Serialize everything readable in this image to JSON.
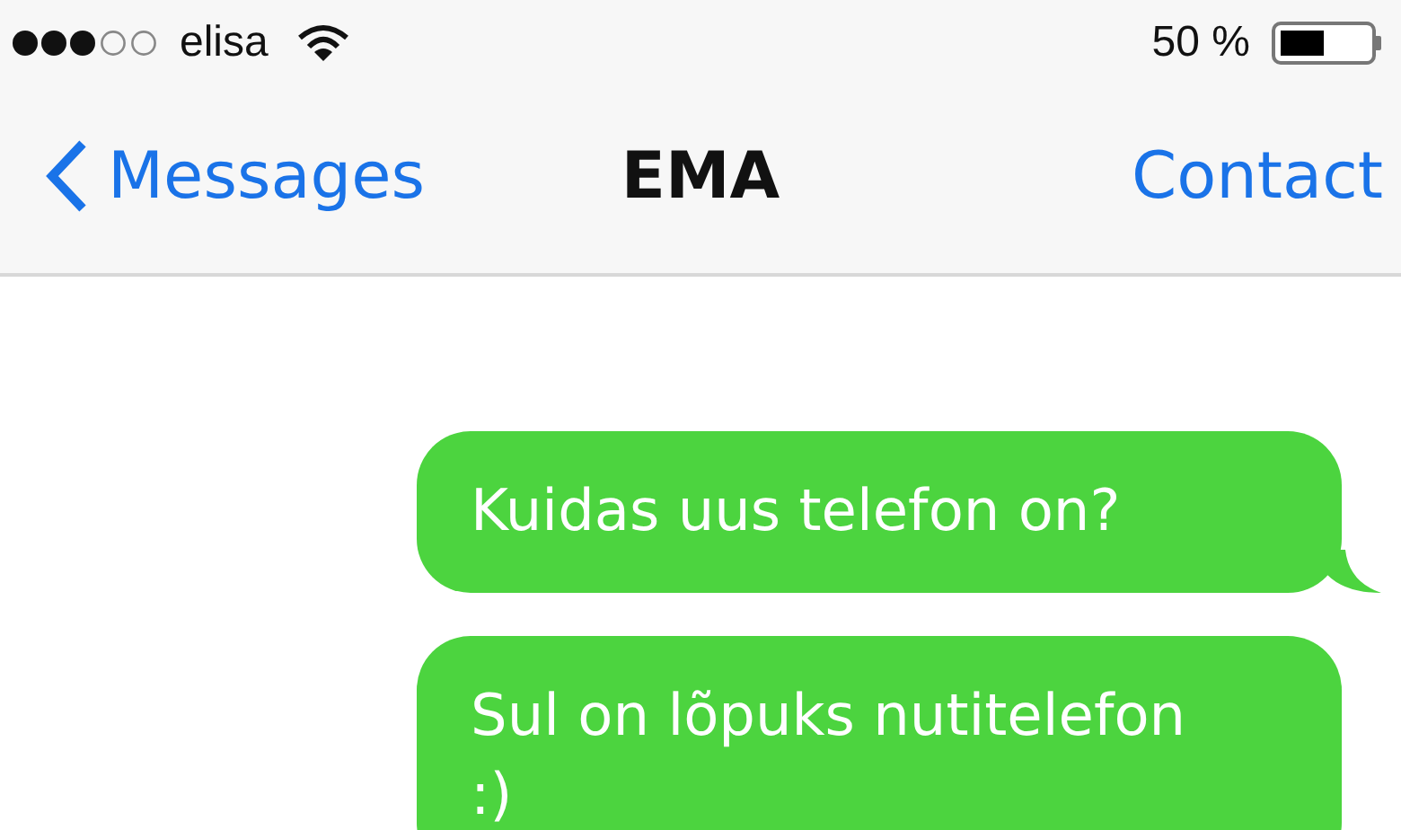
{
  "status_bar": {
    "carrier": "elisa",
    "battery_text": "50 %"
  },
  "nav_bar": {
    "back": "Messages",
    "title": "EMA",
    "action": "Contact"
  },
  "messages": [
    {
      "kind": "sent",
      "text": "Kuidas uus telefon on?"
    },
    {
      "kind": "sent",
      "text": "Sul on lõpuks nutitelefon\n:)"
    }
  ]
}
